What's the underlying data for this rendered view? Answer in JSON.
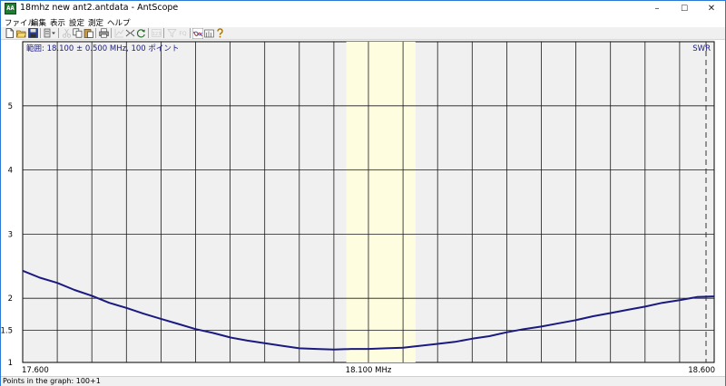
{
  "window": {
    "title": "18mhz new ant2.antdata - AntScope",
    "app_icon_text": "AA",
    "minimize_glyph": "–",
    "maximize_glyph": "☐",
    "close_glyph": "✕"
  },
  "menu": [
    "ファイル",
    "編集",
    "表示",
    "設定",
    "測定",
    "ヘルプ"
  ],
  "toolbar": {
    "buttons": [
      {
        "name": "new-file-icon",
        "enabled": true
      },
      {
        "name": "open-file-icon",
        "enabled": true
      },
      {
        "name": "save-icon",
        "enabled": true
      },
      {
        "name": "data-dropdown-icon",
        "enabled": true
      },
      {
        "name": "cut-icon",
        "enabled": false
      },
      {
        "name": "copy-icon",
        "enabled": true
      },
      {
        "name": "paste-icon",
        "enabled": true
      },
      {
        "name": "print-icon",
        "enabled": true
      },
      {
        "name": "chart-icon",
        "enabled": false
      },
      {
        "name": "markers-icon",
        "enabled": true
      },
      {
        "name": "refresh-icon",
        "enabled": true
      },
      {
        "name": "grid-icon",
        "enabled": false
      },
      {
        "name": "filter-icon",
        "enabled": false
      },
      {
        "name": "fq-icon",
        "enabled": false
      },
      {
        "name": "swr-graph-icon",
        "enabled": true
      },
      {
        "name": "smith-chart-icon",
        "enabled": true
      },
      {
        "name": "help-icon",
        "enabled": true
      }
    ],
    "fq_label": "FQ",
    "grid_label": "123"
  },
  "chart_data": {
    "type": "line",
    "title": "範囲: 18.100 ± 0.500 MHz, 100 ポイント",
    "series_label": "SWR",
    "series": [
      {
        "name": "SWR",
        "color": "#1a1a80",
        "x": [
          17.6,
          17.625,
          17.65,
          17.675,
          17.7,
          17.725,
          17.75,
          17.775,
          17.8,
          17.825,
          17.85,
          17.875,
          17.9,
          17.925,
          17.95,
          17.975,
          18.0,
          18.025,
          18.05,
          18.075,
          18.1,
          18.125,
          18.15,
          18.175,
          18.2,
          18.225,
          18.25,
          18.275,
          18.3,
          18.325,
          18.35,
          18.375,
          18.4,
          18.425,
          18.45,
          18.475,
          18.5,
          18.525,
          18.55,
          18.575,
          18.6
        ],
        "y": [
          2.43,
          2.32,
          2.24,
          2.13,
          2.04,
          1.93,
          1.85,
          1.76,
          1.68,
          1.6,
          1.52,
          1.46,
          1.39,
          1.34,
          1.3,
          1.26,
          1.22,
          1.21,
          1.2,
          1.21,
          1.21,
          1.22,
          1.23,
          1.26,
          1.29,
          1.32,
          1.37,
          1.41,
          1.47,
          1.52,
          1.56,
          1.61,
          1.66,
          1.72,
          1.77,
          1.82,
          1.87,
          1.93,
          1.97,
          2.02,
          2.03
        ]
      }
    ],
    "xlim": [
      17.6,
      18.6
    ],
    "ylim": [
      1,
      6
    ],
    "x_ticks": [
      {
        "value": 17.6,
        "label": "17.600"
      },
      {
        "value": 18.1,
        "label": "18.100 MHz"
      },
      {
        "value": 18.6,
        "label": "18.600"
      }
    ],
    "x_grid_count": 20,
    "y_ticks": [
      {
        "value": 1,
        "label": "1"
      },
      {
        "value": 1.5,
        "label": "1.5"
      },
      {
        "value": 2,
        "label": "2"
      },
      {
        "value": 3,
        "label": "3"
      },
      {
        "value": 4,
        "label": "4"
      },
      {
        "value": 5,
        "label": "5"
      }
    ],
    "band_highlight": [
      18.068,
      18.168
    ],
    "band_color": "#fffde0",
    "marker_x": 18.6,
    "grid": true,
    "plot_bg": "#f0f0f0",
    "grid_color": "#1a1a1a"
  },
  "status": {
    "text": "Points in the graph: 100+1"
  }
}
